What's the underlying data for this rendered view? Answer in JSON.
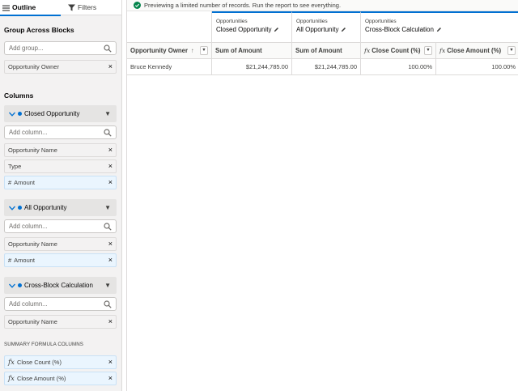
{
  "tabs": {
    "outline": "Outline",
    "filters": "Filters"
  },
  "group_section": {
    "title": "Group Across Blocks",
    "add_placeholder": "Add group...",
    "groups": [
      "Opportunity Owner"
    ]
  },
  "columns_section": {
    "title": "Columns",
    "blocks": [
      {
        "name": "Closed Opportunity",
        "add_placeholder": "Add column...",
        "columns": [
          {
            "label": "Opportunity Name",
            "prefix": ""
          },
          {
            "label": "Type",
            "prefix": ""
          },
          {
            "label": "Amount",
            "prefix": "#"
          }
        ]
      },
      {
        "name": "All Opportunity",
        "add_placeholder": "Add column...",
        "columns": [
          {
            "label": "Opportunity Name",
            "prefix": ""
          },
          {
            "label": "Amount",
            "prefix": "#"
          }
        ]
      },
      {
        "name": "Cross-Block Calculation",
        "add_placeholder": "Add column...",
        "columns": [
          {
            "label": "Opportunity Name",
            "prefix": ""
          }
        ]
      }
    ],
    "summary_title": "SUMMARY FORMULA COLUMNS",
    "summary_columns": [
      "Close Count (%)",
      "Close Amount (%)"
    ]
  },
  "preview": {
    "banner": "Previewing a limited number of records. Run the report to see everything.",
    "blocks": [
      {
        "object": "Opportunities",
        "name": "Closed Opportunity"
      },
      {
        "object": "Opportunities",
        "name": "All Opportunity"
      },
      {
        "object": "Opportunities",
        "name": "Cross-Block Calculation"
      }
    ],
    "headers": [
      "Opportunity Owner",
      "Sum of Amount",
      "Sum of Amount",
      "Close Count (%)",
      "Close Amount (%)"
    ],
    "sort_indicator": "↑",
    "rows": [
      [
        "Bruce Kennedy",
        "$21,244,785.00",
        "$21,244,785.00",
        "100.00%",
        "100.00%"
      ]
    ]
  },
  "colors": {
    "accent": "#0070d2",
    "success": "#04844b"
  }
}
